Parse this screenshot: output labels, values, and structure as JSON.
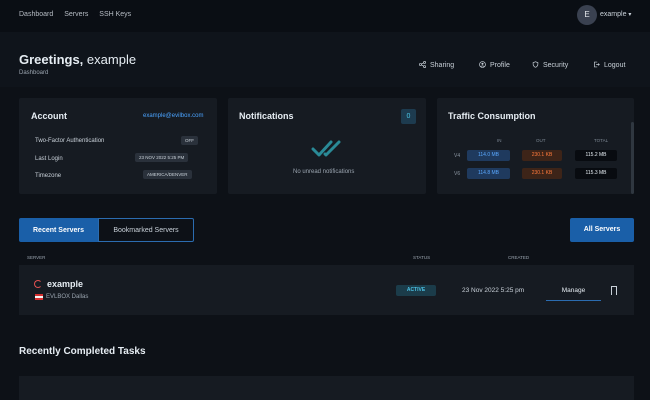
{
  "topnav": {
    "links": [
      "Dashboard",
      "Servers",
      "SSH Keys"
    ],
    "avatar_letter": "E",
    "username": "example"
  },
  "header": {
    "greeting": "Greetings,",
    "greeting_name": "example",
    "subtitle": "Dashboard",
    "nav": {
      "sharing": "Sharing",
      "profile": "Profile",
      "security": "Security",
      "logout": "Logout"
    }
  },
  "account": {
    "title": "Account",
    "email": "example@evilbox.com",
    "rows": [
      {
        "label": "Two-Factor Authentication",
        "value": "OFF"
      },
      {
        "label": "Last Login",
        "value": "23 NOV 2022 5:25 PM"
      },
      {
        "label": "Timezone",
        "value": "AMERICA/DENVER"
      }
    ]
  },
  "notifications": {
    "title": "Notifications",
    "count": "0",
    "empty_text": "No unread notifications"
  },
  "traffic": {
    "title": "Traffic Consumption",
    "headers": [
      "IN",
      "OUT",
      "TOTAL"
    ],
    "rows": [
      {
        "label": "V4",
        "in": "114.0 MB",
        "out": "230.1 KB",
        "total": "115.2 MB"
      },
      {
        "label": "V6",
        "in": "114.8 MB",
        "out": "230.1 KB",
        "total": "115.3 MB"
      }
    ]
  },
  "tabs": {
    "recent": "Recent Servers",
    "bookmarked": "Bookmarked Servers",
    "all_button": "All Servers"
  },
  "table": {
    "headers": {
      "server": "SERVER",
      "status": "STATUS",
      "created": "CREATED"
    },
    "row": {
      "name": "example",
      "location": "EVLBOX Dallas",
      "status": "ACTIVE",
      "created": "23 Nov 2022 5:25 pm",
      "manage": "Manage"
    }
  },
  "tasks": {
    "title": "Recently Completed Tasks"
  },
  "colors": {
    "accent": "#1a5fa8",
    "background": "#0d1117",
    "card": "#161b22",
    "active_status": "#4cc3e6",
    "traffic_in": "#5aa8ff",
    "traffic_out": "#ff7a3d"
  },
  "icons": {
    "sharing": "share-icon",
    "profile": "user-icon",
    "security": "shield-icon",
    "logout": "logout-icon",
    "notifications_empty": "double-check-icon",
    "server_status": "spinner-icon",
    "bookmark": "bookmark-icon",
    "user_menu": "caret-down-icon",
    "location": "flag-icon"
  }
}
